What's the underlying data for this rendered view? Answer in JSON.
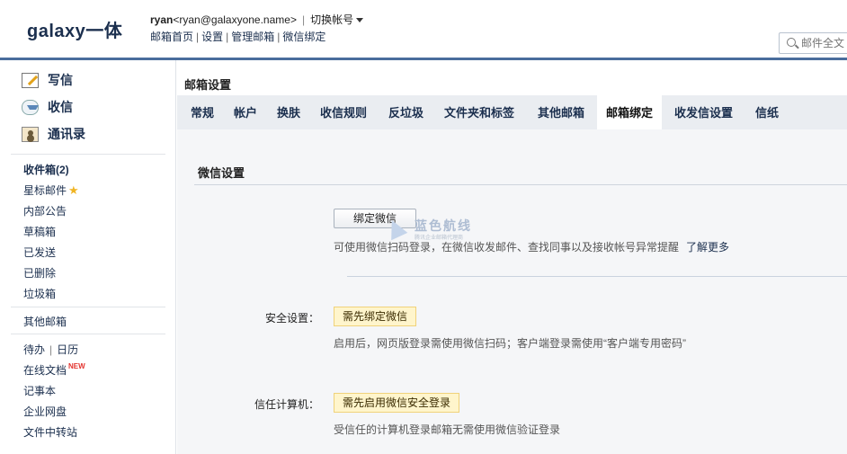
{
  "header": {
    "logo": "galaxy一体",
    "username": "ryan",
    "email": "<ryan@galaxyone.name>",
    "separator": "|",
    "switch_account": "切换帐号",
    "links": [
      "邮箱首页",
      "设置",
      "管理邮箱",
      "微信绑定"
    ],
    "search_placeholder": "邮件全文",
    "accent_color": "#4a6d9c"
  },
  "sidebar": {
    "actions": [
      {
        "label": "写信",
        "icon": "pencil-icon"
      },
      {
        "label": "收信",
        "icon": "inbox-icon"
      },
      {
        "label": "通讯录",
        "icon": "contacts-icon"
      }
    ],
    "folders": [
      {
        "label": "收件箱(2)"
      },
      {
        "label": "星标邮件",
        "badge": "★"
      },
      {
        "label": "内部公告"
      },
      {
        "label": "草稿箱"
      },
      {
        "label": "已发送"
      },
      {
        "label": "已删除"
      },
      {
        "label": "垃圾箱"
      }
    ],
    "other_mailbox": "其他邮箱",
    "tools": {
      "todo": "待办",
      "calendar": "日历",
      "online_docs": "在线文档",
      "new_badge": "NEW",
      "notes": "记事本",
      "netdisk": "企业网盘",
      "file_transfer": "文件中转站"
    }
  },
  "main": {
    "title": "邮箱设置",
    "tabs": [
      "常规",
      "帐户",
      "换肤",
      "收信规则",
      "反垃圾",
      "文件夹和标签",
      "其他邮箱",
      "邮箱绑定",
      "收发信设置",
      "信纸"
    ],
    "active_tab": "邮箱绑定",
    "section_title": "微信设置",
    "bind_button": "绑定微信",
    "bind_desc": "可使用微信扫码登录，在微信收发邮件、查找同事以及接收帐号异常提醒",
    "learn_more": "了解更多",
    "security": {
      "label": "安全设置：",
      "hint": "需先绑定微信",
      "desc": "启用后，网页版登录需使用微信扫码；客户端登录需使用“客户端专用密码”"
    },
    "trusted": {
      "label": "信任计算机：",
      "hint": "需先启用微信安全登录",
      "desc": "受信任的计算机登录邮箱无需使用微信验证登录"
    }
  },
  "watermark": {
    "text": "蓝色航线",
    "sub": "腾讯企业邮箱代理商"
  }
}
